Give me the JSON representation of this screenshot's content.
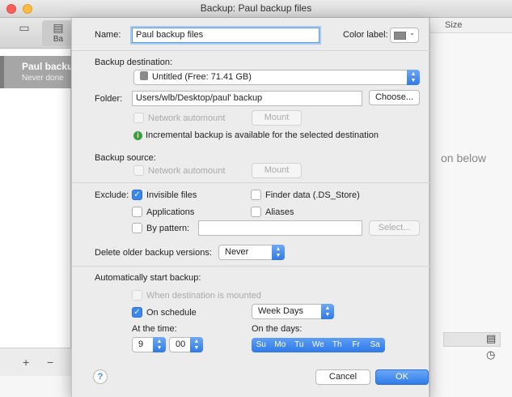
{
  "window": {
    "title": "Backup: Paul backup files"
  },
  "background": {
    "toolbar_label": "Ba",
    "sidebar_item": {
      "name": "Paul backu",
      "status": "Never done"
    },
    "column_header": "Size",
    "hint": "on below",
    "footer": {
      "add": "+",
      "remove": "−"
    }
  },
  "form": {
    "name_label": "Name:",
    "name_value": "Paul backup files",
    "color_label": "Color label:",
    "destination_label": "Backup destination:",
    "destination_value": "Untitled (Free: 71.41 GB)",
    "folder_label": "Folder:",
    "folder_value": "Users/wlb/Desktop/paul' backup",
    "choose_button": "Choose...",
    "network_automount": "Network automount",
    "mount_button": "Mount",
    "incremental_info": "Incremental backup is available for the selected destination",
    "source_label": "Backup source:",
    "exclude_label": "Exclude:",
    "exclude": {
      "invisible_files": "Invisible files",
      "finder_data": "Finder data (.DS_Store)",
      "applications": "Applications",
      "aliases": "Aliases",
      "by_pattern": "By pattern:",
      "select_button": "Select..."
    },
    "delete_label": "Delete older backup versions:",
    "delete_value": "Never",
    "auto_label": "Automatically start backup:",
    "when_mounted": "When destination is mounted",
    "on_schedule": "On schedule",
    "schedule_value": "Week Days",
    "at_time_label": "At the time:",
    "hour": "9",
    "minute": "00",
    "on_days_label": "On the days:",
    "days": [
      "Su",
      "Mo",
      "Tu",
      "We",
      "Th",
      "Fr",
      "Sa"
    ],
    "help": "?",
    "cancel_button": "Cancel",
    "ok_button": "OK"
  }
}
